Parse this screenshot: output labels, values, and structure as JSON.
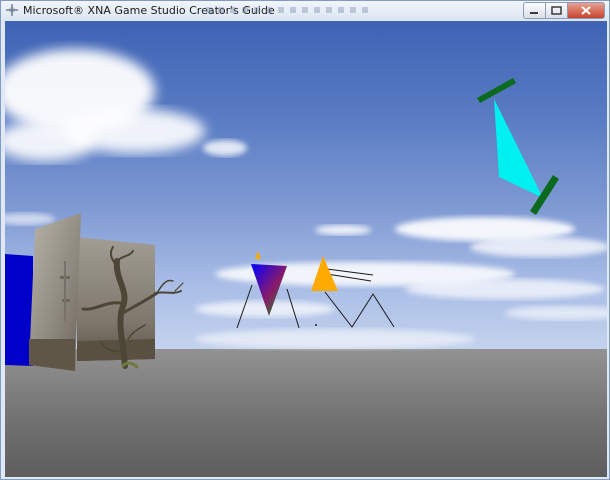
{
  "window": {
    "title": "Microsoft® XNA Game Studio Creator's Guide"
  },
  "colors": {
    "sky_top": "#3f63b4",
    "sky_bottom": "#c8d6ee",
    "ground": "#7a7a7a",
    "cyan_triangle": "#00f0f0",
    "green_bar": "#0b6a1e",
    "orange_triangle": "#ffaa00",
    "blue_panel": "#0000cc"
  },
  "scene_objects": [
    "cyan-triangle",
    "green-bar-top",
    "green-bar-bottom",
    "gradient-triangle",
    "orange-triangle",
    "small-orange-marker",
    "line-strip-left",
    "line-strip-right",
    "line-list",
    "blue-wall",
    "stone-walls",
    "dead-tree",
    "ground-plane",
    "skybox-clouds"
  ]
}
